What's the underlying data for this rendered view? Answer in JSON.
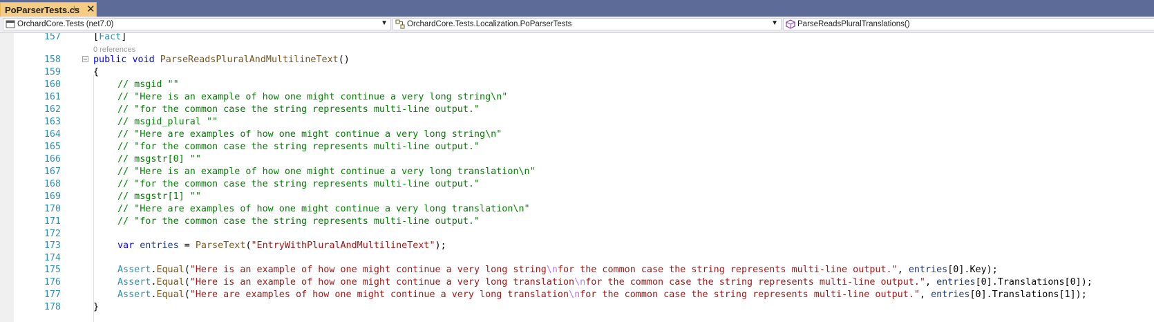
{
  "tab": {
    "title": "PoParserTests.cs",
    "pin_icon": "pin-icon",
    "close_icon": "close-icon"
  },
  "nav": {
    "project": "OrchardCore.Tests (net7.0)",
    "type": "OrchardCore.Tests.Localization.PoParserTests",
    "member": "ParseReadsPluralTranslations()"
  },
  "editor": {
    "codelens": "0 references",
    "lines": {
      "l157": {
        "num": "157",
        "attr": "Fact"
      },
      "l158": {
        "num": "158",
        "kw1": "public",
        "kw2": "void",
        "method": "ParseReadsPluralAndMultilineText",
        "rest": "()"
      },
      "l159": {
        "num": "159",
        "text": "{"
      },
      "l160": {
        "num": "160",
        "text": "// msgid \"\""
      },
      "l161": {
        "num": "161",
        "text": "// \"Here is an example of how one might continue a very long string\\n\""
      },
      "l162": {
        "num": "162",
        "text": "// \"for the common case the string represents multi-line output.\""
      },
      "l163": {
        "num": "163",
        "text": "// msgid_plural \"\""
      },
      "l164": {
        "num": "164",
        "text": "// \"Here are examples of how one might continue a very long string\\n\""
      },
      "l165": {
        "num": "165",
        "text": "// \"for the common case the string represents multi-line output.\""
      },
      "l166": {
        "num": "166",
        "text": "// msgstr[0] \"\""
      },
      "l167": {
        "num": "167",
        "text": "// \"Here is an example of how one might continue a very long translation\\n\""
      },
      "l168": {
        "num": "168",
        "text": "// \"for the common case the string represents multi-line output.\""
      },
      "l169": {
        "num": "169",
        "text": "// msgstr[1] \"\""
      },
      "l170": {
        "num": "170",
        "text": "// \"Here are examples of how one might continue a very long translation\\n\""
      },
      "l171": {
        "num": "171",
        "text": "// \"for the common case the string represents multi-line output.\""
      },
      "l172": {
        "num": "172"
      },
      "l173": {
        "num": "173",
        "kw": "var",
        "var": "entries",
        "eq": " = ",
        "method": "ParseText",
        "open": "(",
        "str": "\"EntryWithPluralAndMultilineText\"",
        "close": ");"
      },
      "l174": {
        "num": "174"
      },
      "l175": {
        "num": "175",
        "cls": "Assert",
        "dot": ".",
        "method": "Equal",
        "open": "(",
        "str1": "\"Here is an example of how one might continue a very long string",
        "esc": "\\n",
        "str2": "for the common case the string represents multi-line output.\"",
        "sep": ", ",
        "var": "entries",
        "tail": "[0].Key);"
      },
      "l176": {
        "num": "176",
        "cls": "Assert",
        "dot": ".",
        "method": "Equal",
        "open": "(",
        "str1": "\"Here is an example of how one might continue a very long translation",
        "esc": "\\n",
        "str2": "for the common case the string represents multi-line output.\"",
        "sep": ", ",
        "var": "entries",
        "tail": "[0].Translations[0]);"
      },
      "l177": {
        "num": "177",
        "cls": "Assert",
        "dot": ".",
        "method": "Equal",
        "open": "(",
        "str1": "\"Here are examples of how one might continue a very long translation",
        "esc": "\\n",
        "str2": "for the common case the string represents multi-line output.\"",
        "sep": ", ",
        "var": "entries",
        "tail": "[0].Translations[1]);"
      },
      "l178": {
        "num": "178",
        "text": "}"
      }
    }
  },
  "colors": {
    "keyword": "#0000ff",
    "comment": "#008000",
    "string": "#a31515",
    "type": "#2b91af",
    "method": "#74531f",
    "variable": "#1f377f",
    "escape": "#b776fb",
    "tab_active": "#f5cc84",
    "tabbar": "#5d6b99"
  }
}
